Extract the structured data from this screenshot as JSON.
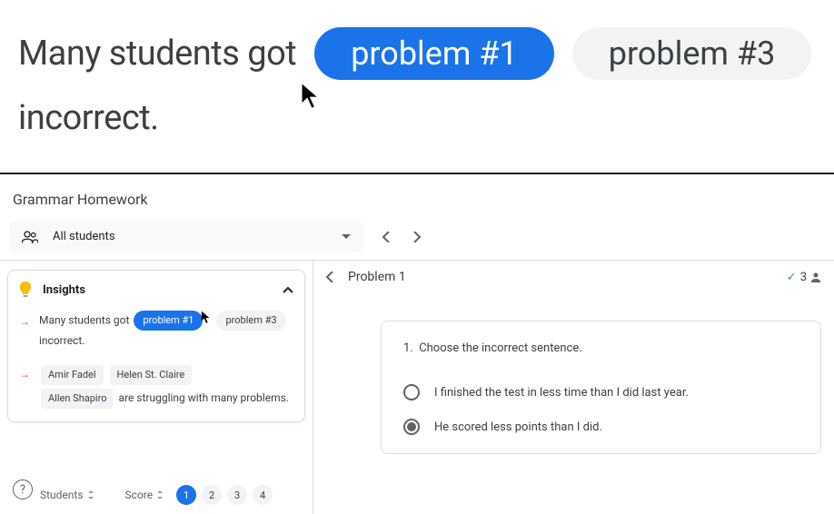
{
  "overlay": {
    "text_prefix": "Many students got",
    "text_suffix": "incorrect.",
    "pill1": "problem #1",
    "pill2": "problem #3"
  },
  "app": {
    "title": "Grammar Homework"
  },
  "filter": {
    "label": "All students"
  },
  "insights": {
    "title": "Insights",
    "item1": {
      "prefix": "Many students got",
      "pill1": "problem #1",
      "pill2": "problem #3",
      "suffix": "incorrect."
    },
    "item2": {
      "student1": "Amir Fadel",
      "student2": "Helen St. Claire",
      "student3": "Allen Shapiro",
      "text": "are struggling with many problems."
    }
  },
  "table": {
    "col1": "Students",
    "col2": "Score",
    "pages": [
      "1",
      "2",
      "3",
      "4"
    ]
  },
  "problem": {
    "title": "Problem 1",
    "correct_count": "3",
    "question_num": "1.",
    "question": "Choose the incorrect sentence.",
    "option1": "I finished the test in less time than I did last year.",
    "option2": "He scored less points than I did."
  },
  "help": "?"
}
